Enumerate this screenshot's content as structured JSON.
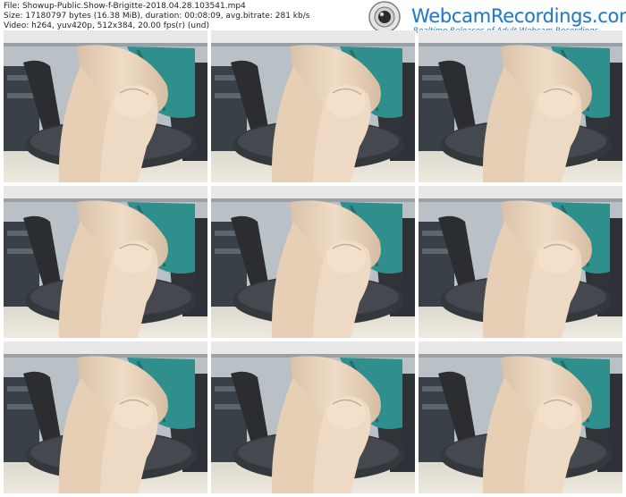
{
  "file_info": {
    "file_line": "File: Showup-Public.Show-f-Brigitte-2018.04.28.103541.mp4",
    "size_line": "Size: 17180797 bytes (16.38 MiB), duration: 00:08:09, avg.bitrate: 281 kb/s",
    "video_line": "Video: h264, yuv420p, 512x384, 20.00 fps(r) (und)"
  },
  "branding": {
    "logo_icon": "webcam-icon",
    "title": "WebcamRecordings.com",
    "tagline": "Realtime Releases of Adult Webcam Recordings",
    "accent_color": "#2a79c2"
  },
  "thumbnails": [
    {
      "variant": "a"
    },
    {
      "variant": "b"
    },
    {
      "variant": "c"
    },
    {
      "variant": "a"
    },
    {
      "variant": "b"
    },
    {
      "variant": "c"
    },
    {
      "variant": "a"
    },
    {
      "variant": "b"
    },
    {
      "variant": "c"
    }
  ]
}
